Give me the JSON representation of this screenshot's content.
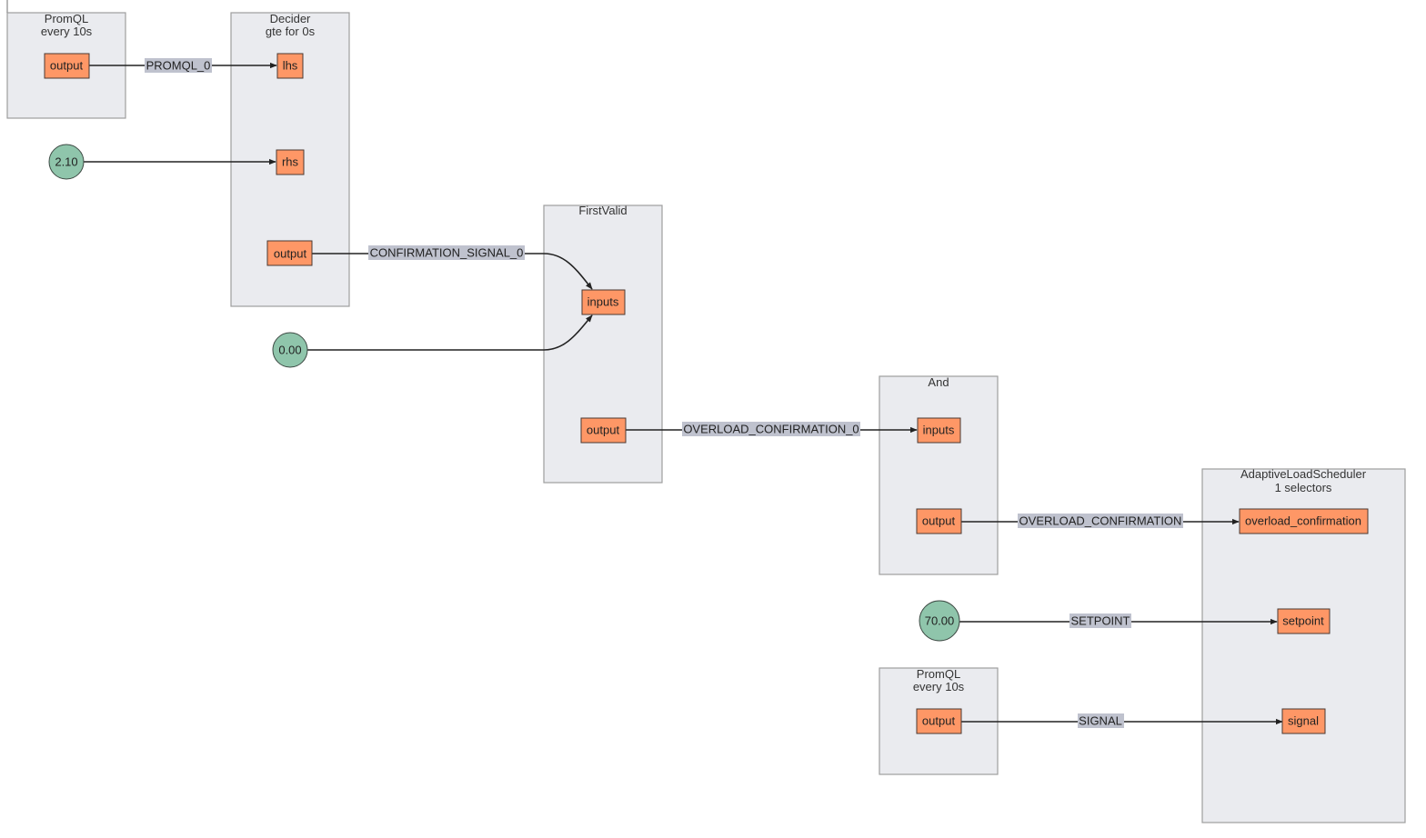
{
  "diagram": {
    "components": [
      {
        "id": "promql1",
        "title": [
          "PromQL",
          "every 10s"
        ],
        "ports": [
          {
            "id": "promql1-output",
            "label": "output"
          }
        ]
      },
      {
        "id": "decider",
        "title": [
          "Decider",
          "gte for 0s"
        ],
        "ports": [
          {
            "id": "decider-lhs",
            "label": "lhs"
          },
          {
            "id": "decider-rhs",
            "label": "rhs"
          },
          {
            "id": "decider-output",
            "label": "output"
          }
        ]
      },
      {
        "id": "firstvalid",
        "title": [
          "FirstValid"
        ],
        "ports": [
          {
            "id": "firstvalid-inputs",
            "label": "inputs"
          },
          {
            "id": "firstvalid-output",
            "label": "output"
          }
        ]
      },
      {
        "id": "and",
        "title": [
          "And"
        ],
        "ports": [
          {
            "id": "and-inputs",
            "label": "inputs"
          },
          {
            "id": "and-output",
            "label": "output"
          }
        ]
      },
      {
        "id": "scheduler",
        "title": [
          "AdaptiveLoadScheduler",
          "1 selectors"
        ],
        "ports": [
          {
            "id": "scheduler-overload",
            "label": "overload_confirmation"
          },
          {
            "id": "scheduler-setpoint",
            "label": "setpoint"
          },
          {
            "id": "scheduler-signal",
            "label": "signal"
          }
        ]
      },
      {
        "id": "promql2",
        "title": [
          "PromQL",
          "every 10s"
        ],
        "ports": [
          {
            "id": "promql2-output",
            "label": "output"
          }
        ]
      }
    ],
    "constants": [
      {
        "id": "const-2-10",
        "value": "2.10"
      },
      {
        "id": "const-0-00",
        "value": "0.00"
      },
      {
        "id": "const-70-00",
        "value": "70.00"
      }
    ],
    "edges": [
      {
        "from": "promql1-output",
        "to": "decider-lhs",
        "label": "PROMQL_0"
      },
      {
        "from": "const-2-10",
        "to": "decider-rhs",
        "label": ""
      },
      {
        "from": "decider-output",
        "to": "firstvalid-inputs",
        "label": "CONFIRMATION_SIGNAL_0"
      },
      {
        "from": "const-0-00",
        "to": "firstvalid-inputs",
        "label": ""
      },
      {
        "from": "firstvalid-output",
        "to": "and-inputs",
        "label": "OVERLOAD_CONFIRMATION_0"
      },
      {
        "from": "and-output",
        "to": "scheduler-overload",
        "label": "OVERLOAD_CONFIRMATION"
      },
      {
        "from": "const-70-00",
        "to": "scheduler-setpoint",
        "label": "SETPOINT"
      },
      {
        "from": "promql2-output",
        "to": "scheduler-signal",
        "label": "SIGNAL"
      }
    ],
    "colors": {
      "group_fill": "#eaebef",
      "port_fill": "#fe9766",
      "constant_fill": "#8fc5ab",
      "edge_label_bg": "#bfc2ce"
    }
  }
}
